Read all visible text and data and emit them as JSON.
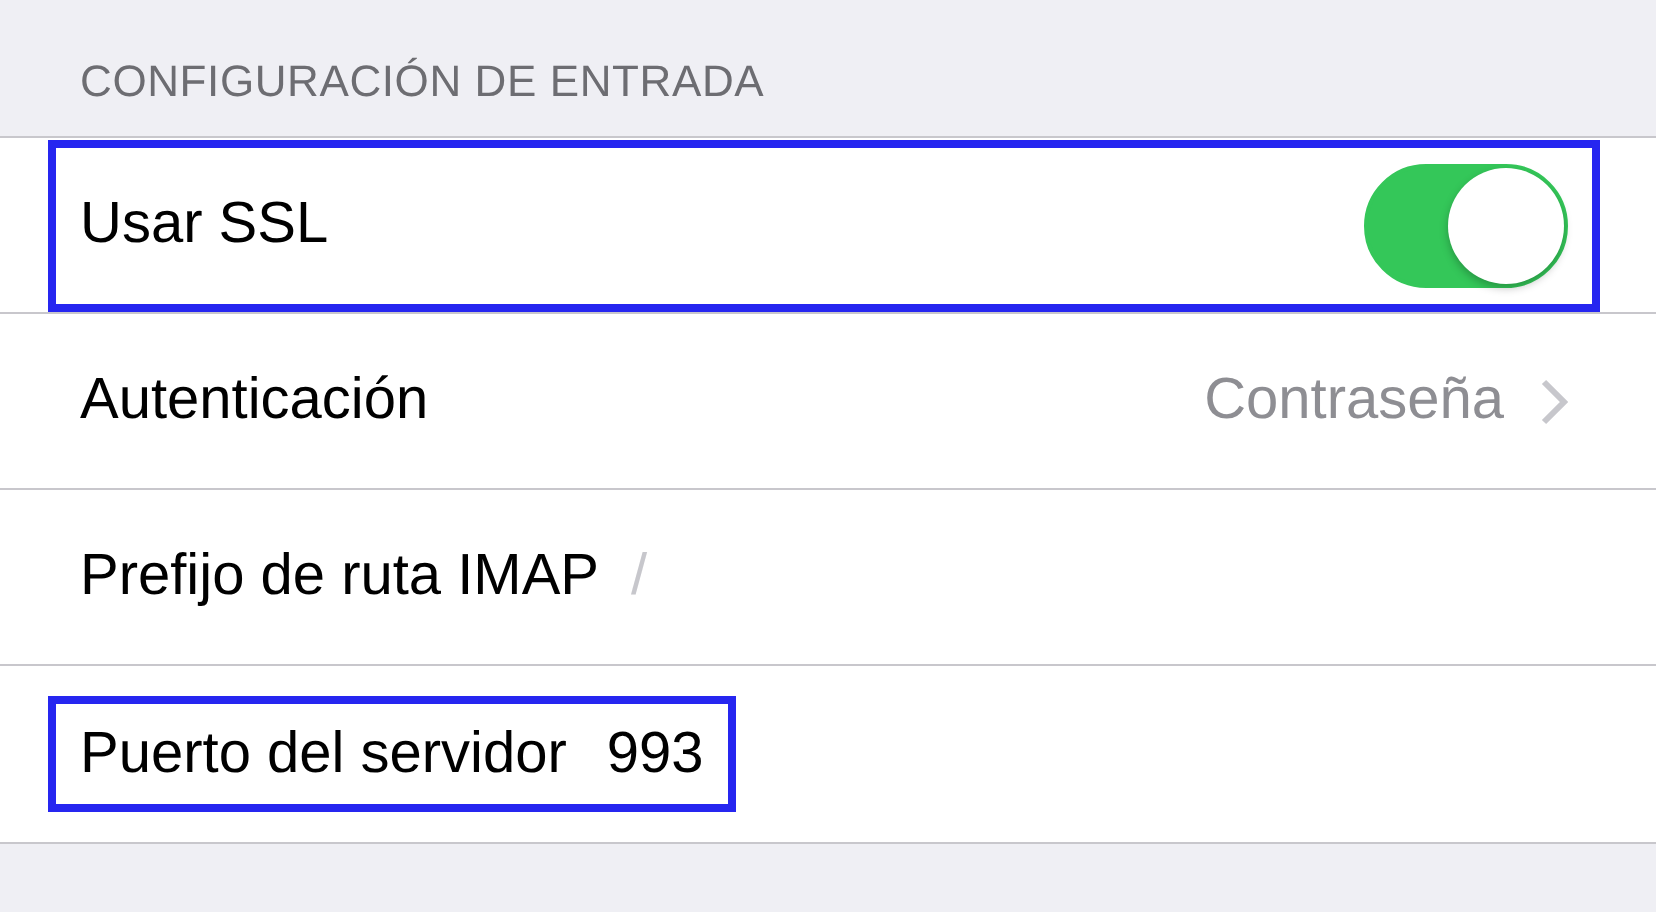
{
  "section": {
    "header": "CONFIGURACIÓN DE ENTRADA"
  },
  "rows": [
    {
      "kind": "toggle",
      "label": "Usar SSL",
      "on": true,
      "highlighted": true
    },
    {
      "kind": "disclosure",
      "label": "Autenticación",
      "value": "Contraseña",
      "highlighted": false
    },
    {
      "kind": "field",
      "label": "Prefijo de ruta IMAP",
      "placeholder": "/",
      "highlighted": false
    },
    {
      "kind": "field",
      "label": "Puerto del servidor",
      "value": "993",
      "highlighted": true
    }
  ]
}
